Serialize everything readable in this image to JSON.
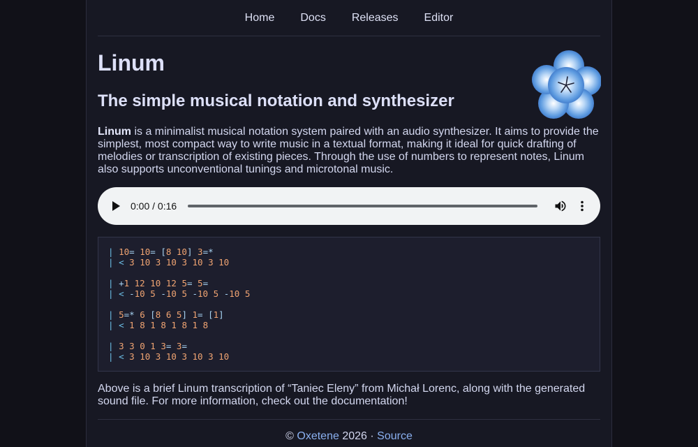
{
  "nav": {
    "items": [
      {
        "label": "Home"
      },
      {
        "label": "Docs"
      },
      {
        "label": "Releases"
      },
      {
        "label": "Editor"
      }
    ]
  },
  "header": {
    "title": "Linum",
    "subtitle": "The simple musical notation and synthesizer",
    "logo_icon": "flower-logo-icon"
  },
  "intro": {
    "bold": "Linum",
    "text": " is a minimalist musical notation system paired with an audio synthesizer. It aims to provide the simplest, most compact way to write music in a textual format, making it ideal for quick drafting of melodies or transcription of existing pieces. Through the use of numbers to represent notes, Linum also supports unconventional tunings and microtonal music."
  },
  "audio": {
    "time": "0:00 / 0:16",
    "play_icon": "play-icon",
    "volume_icon": "volume-icon",
    "menu_icon": "more-vert-icon"
  },
  "code_lines": [
    "| 10= 10= [8 10] 3=*",
    "| < 3 10 3 10 3 10 3 10",
    "",
    "| +1 12 10 12 5= 5=",
    "| < -10 5 -10 5 -10 5 -10 5",
    "",
    "| 5=* 6 [8 6 5] 1= [1]",
    "| < 1 8 1 8 1 8 1 8",
    "",
    "| 3 3 0 1 3= 3=",
    "| < 3 10 3 10 3 10 3 10"
  ],
  "outro": {
    "text": "Above is a brief Linum transcription of “Taniec Eleny” from Michał Lorenc, along with the generated sound file. For more information, check out the documentation!"
  },
  "footer": {
    "copyright": "© ",
    "author": "Oxetene",
    "year": " 2026 · ",
    "source": "Source"
  },
  "colors": {
    "accent": "#8ab0f0",
    "code_number": "#f0a472",
    "code_bar": "#6ec2ea"
  }
}
